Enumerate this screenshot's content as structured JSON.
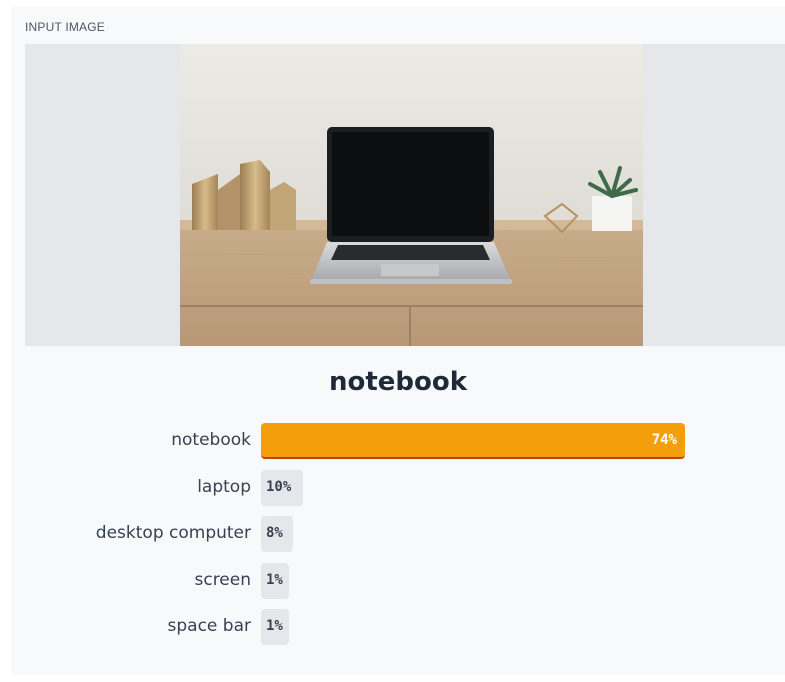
{
  "section": {
    "label": "INPUT IMAGE"
  },
  "result": {
    "title": "notebook",
    "predictions": [
      {
        "label": "notebook",
        "value": "74%",
        "fraction": 0.74
      },
      {
        "label": "laptop",
        "value": "10%",
        "fraction": 0.1
      },
      {
        "label": "desktop computer",
        "value": "8%",
        "fraction": 0.08
      },
      {
        "label": "screen",
        "value": "1%",
        "fraction": 0.01
      },
      {
        "label": "space bar",
        "value": "1%",
        "fraction": 0.01
      }
    ]
  },
  "colors": {
    "top_bar": "#f59e0b",
    "other_bar": "#e5e7eb"
  }
}
